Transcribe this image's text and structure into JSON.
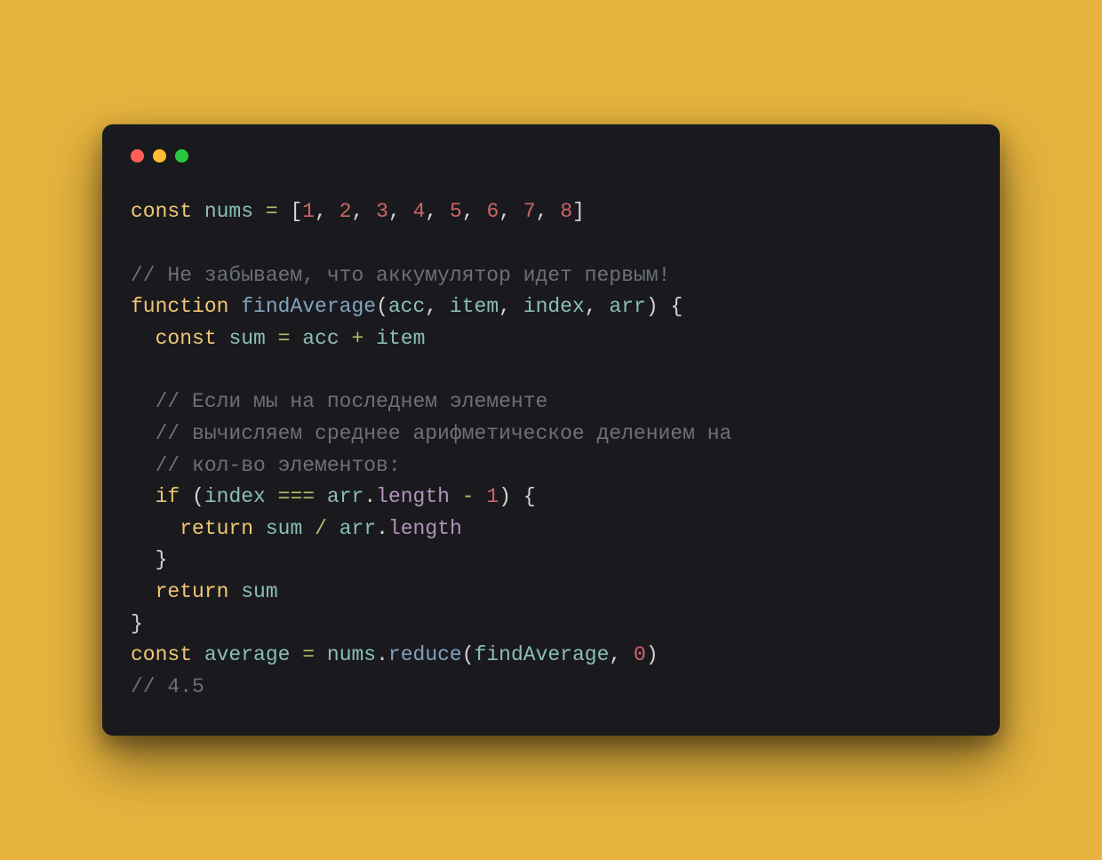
{
  "colors": {
    "page_bg": "#e5b33e",
    "window_bg": "#1a1a1e",
    "traffic_red": "#ff5f57",
    "traffic_yellow": "#febc2e",
    "traffic_green": "#28c840",
    "keyword": "#f0c674",
    "identifier": "#8abeb7",
    "function": "#81a2be",
    "property": "#b294bb",
    "number": "#cc6666",
    "operator": "#b5bd68",
    "comment": "#6c7176",
    "default": "#d4d4d4"
  },
  "tokens": {
    "const": "const",
    "function": "function",
    "if": "if",
    "return": "return",
    "nums": "nums",
    "findAverage": "findAverage",
    "acc": "acc",
    "item": "item",
    "index": "index",
    "arr": "arr",
    "sum": "sum",
    "average": "average",
    "reduce": "reduce",
    "length": "length",
    "eq": "=",
    "tripleEq": "===",
    "plus": "+",
    "minus": "-",
    "slash": "/",
    "dot": ".",
    "comma": ",",
    "lparen": "(",
    "rparen": ")",
    "lbrack": "[",
    "rbrack": "]",
    "lbrace": "{",
    "rbrace": "}",
    "n1": "1",
    "n2": "2",
    "n3": "3",
    "n4": "4",
    "n5": "5",
    "n6": "6",
    "n7": "7",
    "n8": "8",
    "zero": "0",
    "cmt1": "// Не забываем, что аккумулятор идет первым!",
    "cmt2": "// Если мы на последнем элементе",
    "cmt3": "// вычисляем среднее арифметическое делением на",
    "cmt4": "// кол-во элементов:",
    "cmt5": "// 4.5"
  },
  "code_plain": "const nums = [1, 2, 3, 4, 5, 6, 7, 8]\n\n// Не забываем, что аккумулятор идет первым!\nfunction findAverage(acc, item, index, arr) {\n  const sum = acc + item\n\n  // Если мы на последнем элементе\n  // вычисляем среднее арифметическое делением на\n  // кол-во элементов:\n  if (index === arr.length - 1) {\n    return sum / arr.length\n  }\n  return sum\n}\nconst average = nums.reduce(findAverage, 0)\n// 4.5"
}
